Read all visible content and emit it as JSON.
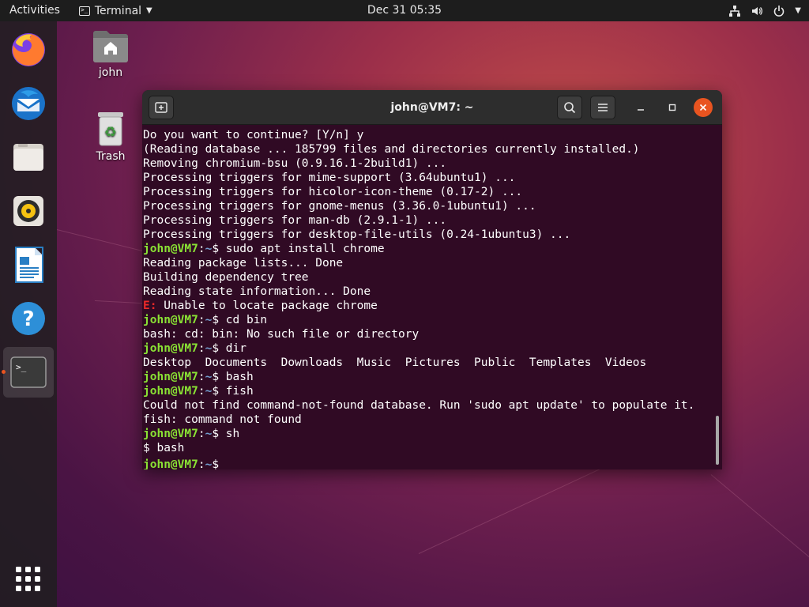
{
  "topbar": {
    "activities": "Activities",
    "app_name": "Terminal",
    "clock": "Dec 31  05:35"
  },
  "dock": {
    "items": [
      "firefox-icon",
      "thunderbird-icon",
      "files-icon",
      "rhythmbox-icon",
      "libreoffice-writer-icon",
      "help-icon",
      "terminal-icon"
    ],
    "show_apps": "show-applications-icon"
  },
  "desktop": {
    "home_label": "john",
    "trash_label": "Trash"
  },
  "window": {
    "title": "john@VM7: ~"
  },
  "terminal": {
    "lines": [
      {
        "type": "out",
        "text": "Do you want to continue? [Y/n] y"
      },
      {
        "type": "out",
        "text": "(Reading database ... 185799 files and directories currently installed.)"
      },
      {
        "type": "out",
        "text": "Removing chromium-bsu (0.9.16.1-2build1) ..."
      },
      {
        "type": "out",
        "text": "Processing triggers for mime-support (3.64ubuntu1) ..."
      },
      {
        "type": "out",
        "text": "Processing triggers for hicolor-icon-theme (0.17-2) ..."
      },
      {
        "type": "out",
        "text": "Processing triggers for gnome-menus (3.36.0-1ubuntu1) ..."
      },
      {
        "type": "out",
        "text": "Processing triggers for man-db (2.9.1-1) ..."
      },
      {
        "type": "out",
        "text": "Processing triggers for desktop-file-utils (0.24-1ubuntu3) ..."
      },
      {
        "type": "prompt",
        "user": "john@VM7",
        "sep": ":",
        "path": "~",
        "sym": "$ ",
        "cmd": "sudo apt install chrome"
      },
      {
        "type": "out",
        "text": "Reading package lists... Done"
      },
      {
        "type": "out",
        "text": "Building dependency tree"
      },
      {
        "type": "out",
        "text": "Reading state information... Done"
      },
      {
        "type": "err",
        "label": "E:",
        "text": " Unable to locate package chrome"
      },
      {
        "type": "prompt",
        "user": "john@VM7",
        "sep": ":",
        "path": "~",
        "sym": "$ ",
        "cmd": "cd bin"
      },
      {
        "type": "out",
        "text": "bash: cd: bin: No such file or directory"
      },
      {
        "type": "prompt",
        "user": "john@VM7",
        "sep": ":",
        "path": "~",
        "sym": "$ ",
        "cmd": "dir"
      },
      {
        "type": "out",
        "text": "Desktop  Documents  Downloads  Music  Pictures  Public  Templates  Videos"
      },
      {
        "type": "prompt",
        "user": "john@VM7",
        "sep": ":",
        "path": "~",
        "sym": "$ ",
        "cmd": "bash"
      },
      {
        "type": "prompt",
        "user": "john@VM7",
        "sep": ":",
        "path": "~",
        "sym": "$ ",
        "cmd": "fish"
      },
      {
        "type": "out",
        "text": "Could not find command-not-found database. Run 'sudo apt update' to populate it."
      },
      {
        "type": "out",
        "text": "fish: command not found"
      },
      {
        "type": "prompt",
        "user": "john@VM7",
        "sep": ":",
        "path": "~",
        "sym": "$ ",
        "cmd": "sh"
      },
      {
        "type": "out",
        "text": "$ bash"
      },
      {
        "type": "prompt",
        "user": "john@VM7",
        "sep": ":",
        "path": "~",
        "sym": "$ ",
        "cmd": ""
      }
    ]
  },
  "colors": {
    "accent": "#e95420",
    "terminal_bg": "#300a24",
    "prompt_user": "#8ae234",
    "prompt_path": "#729fcf",
    "error": "#ef2929"
  }
}
